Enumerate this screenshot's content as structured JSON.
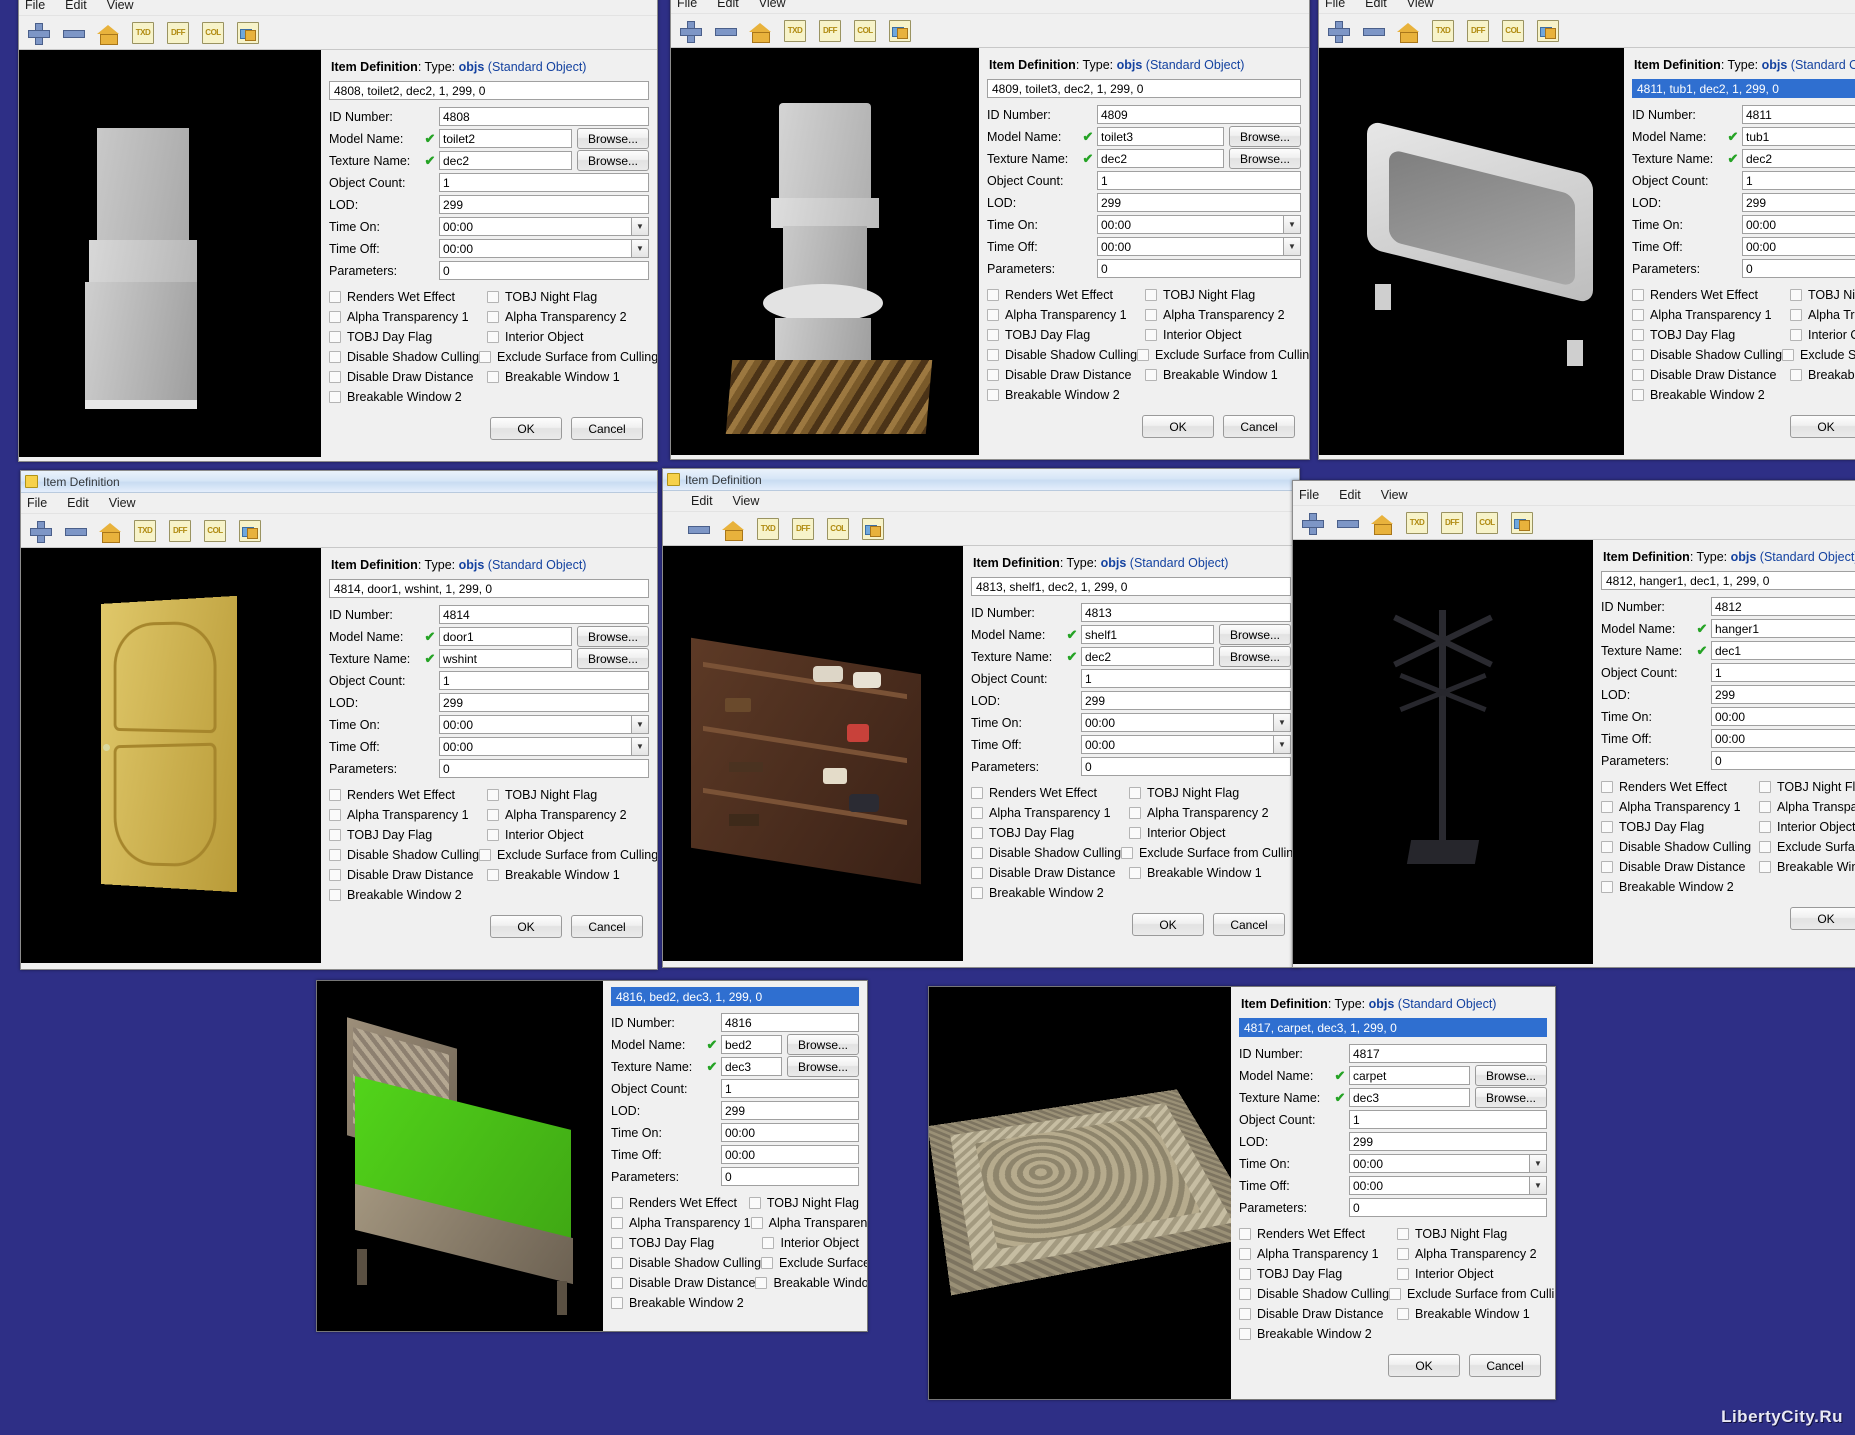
{
  "app": {
    "window_title": "Item Definition",
    "menus": [
      "File",
      "Edit",
      "View"
    ],
    "toolbar_icons": [
      "add-icon",
      "remove-icon",
      "home-icon",
      "txd-icon",
      "dff-icon",
      "col-icon",
      "img-icon"
    ],
    "watermark": "LibertyCity.Ru"
  },
  "labels": {
    "header_prefix": "Item Definition",
    "header_type": "Type:",
    "header_objs": "objs",
    "header_paren": "(Standard Object)",
    "id_number": "ID Number:",
    "model_name": "Model Name:",
    "texture_name": "Texture Name:",
    "object_count": "Object Count:",
    "lod": "LOD:",
    "time_on": "Time On:",
    "time_off": "Time Off:",
    "parameters": "Parameters:",
    "browse": "Browse...",
    "ok": "OK",
    "cancel": "Cancel",
    "checkmark": "✔"
  },
  "checkboxes": {
    "left": [
      "Renders Wet Effect",
      "Alpha Transparency 1",
      "TOBJ Day Flag",
      "Disable Shadow Culling",
      "Disable Draw Distance",
      "Breakable Window 2"
    ],
    "right": [
      "TOBJ Night Flag",
      "Alpha Transparency 2",
      "Interior Object",
      "Exclude Surface from Culling",
      "Breakable Window 1"
    ]
  },
  "dialogs": [
    {
      "key": "toilet2",
      "definition": "4808, toilet2, dec2, 1, 299, 0",
      "id_number": "4808",
      "model_name": "toilet2",
      "texture_name": "dec2",
      "object_count": "1",
      "lod": "299",
      "time_on": "00:00",
      "time_off": "00:00",
      "parameters": "0",
      "selected": false
    },
    {
      "key": "toilet3",
      "definition": "4809, toilet3, dec2, 1, 299, 0",
      "id_number": "4809",
      "model_name": "toilet3",
      "texture_name": "dec2",
      "object_count": "1",
      "lod": "299",
      "time_on": "00:00",
      "time_off": "00:00",
      "parameters": "0",
      "selected": false
    },
    {
      "key": "tub1",
      "definition": "4811, tub1, dec2, 1, 299, 0",
      "id_number": "4811",
      "model_name": "tub1",
      "texture_name": "dec2",
      "object_count": "1",
      "lod": "299",
      "time_on": "00:00",
      "time_off": "00:00",
      "parameters": "0",
      "selected": true
    },
    {
      "key": "door1",
      "definition": "4814, door1, wshint, 1, 299, 0",
      "id_number": "4814",
      "model_name": "door1",
      "texture_name": "wshint",
      "object_count": "1",
      "lod": "299",
      "time_on": "00:00",
      "time_off": "00:00",
      "parameters": "0",
      "selected": false
    },
    {
      "key": "shelf1",
      "definition": "4813, shelf1, dec2, 1, 299, 0",
      "id_number": "4813",
      "model_name": "shelf1",
      "texture_name": "dec2",
      "object_count": "1",
      "lod": "299",
      "time_on": "00:00",
      "time_off": "00:00",
      "parameters": "0",
      "selected": false
    },
    {
      "key": "hanger1",
      "definition": "4812, hanger1, dec1, 1, 299, 0",
      "id_number": "4812",
      "model_name": "hanger1",
      "texture_name": "dec1",
      "object_count": "1",
      "lod": "299",
      "time_on": "00:00",
      "time_off": "00:00",
      "parameters": "0",
      "selected": false
    },
    {
      "key": "bed2",
      "definition": "4816, bed2, dec3, 1, 299, 0",
      "id_number": "4816",
      "model_name": "bed2",
      "texture_name": "dec3",
      "object_count": "1",
      "lod": "299",
      "time_on": "00:00",
      "time_off": "00:00",
      "parameters": "0",
      "selected": true
    },
    {
      "key": "carpet",
      "definition": "4817, carpet, dec3, 1, 299, 0",
      "id_number": "4817",
      "model_name": "carpet",
      "texture_name": "dec3",
      "object_count": "1",
      "lod": "299",
      "time_on": "00:00",
      "time_off": "00:00",
      "parameters": "0",
      "selected": true
    }
  ]
}
